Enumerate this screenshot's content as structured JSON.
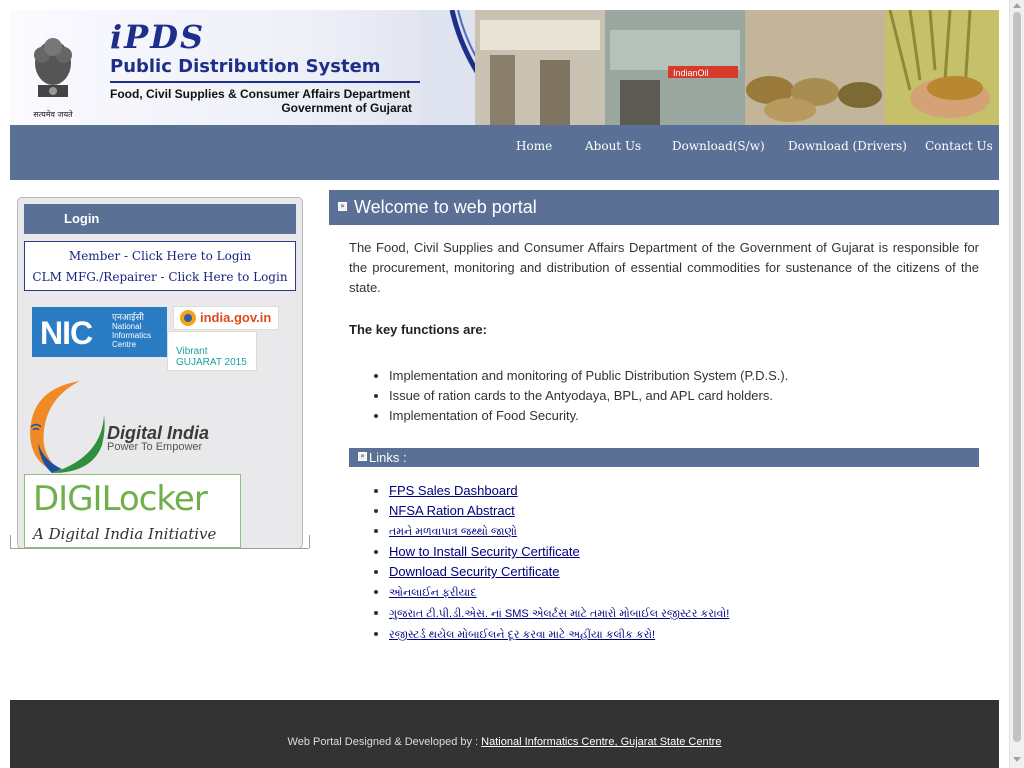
{
  "header": {
    "logo_text": "iPDS",
    "title": "Public Distribution System",
    "department": "Food, Civil Supplies & Consumer Affairs Department",
    "government": "Government of Gujarat",
    "emblem_caption": "सत्यमेव जयते",
    "photo_sign": "IndianOil",
    "brand_color": "#1e2f8a",
    "emblem_icon": "ashoka-emblem-icon"
  },
  "nav": {
    "items": [
      {
        "label": "Home"
      },
      {
        "label": "About Us"
      },
      {
        "label": "Download(S/w)"
      },
      {
        "label": "Download (Drivers)"
      },
      {
        "label": "Contact Us"
      }
    ],
    "bg_color": "#5a7095"
  },
  "sidebar": {
    "login_title": "Login",
    "member_login": "Member - Click Here to Login",
    "clm_login": "CLM MFG./Repairer - Click Here to Login",
    "partners": {
      "nic_big": "NIC",
      "nic_hindi": "एनआईसी",
      "nic_name": "National Informatics Centre",
      "india_gov": "india.gov.in",
      "vibrant": "Vibrant GUJARAT 2015"
    },
    "digital_india": {
      "title": "Digital India",
      "subtitle": "Power To Empower"
    },
    "digilocker": {
      "title": "DIGILocker",
      "subtitle": "A Digital India Initiative"
    }
  },
  "main": {
    "welcome": "Welcome to web portal",
    "intro": "The Food, Civil Supplies and Consumer Affairs Department of the Government of Gujarat is responsible for the procurement, monitoring and distribution of essential commodities for sustenance of the citizens of the state.",
    "key_functions_heading": "The key functions are:",
    "key_functions": [
      "Implementation and monitoring of Public Distribution System (P.D.S.).",
      "Issue of ration cards to the Antyodaya, BPL, and APL card holders.",
      "Implementation of Food Security."
    ],
    "links_heading": "Links :",
    "links": [
      {
        "label": "FPS Sales Dashboard",
        "small": false
      },
      {
        "label": "NFSA Ration Abstract",
        "small": false
      },
      {
        "label": "તમને મળવાપાત્ર જથ્થો જાણો",
        "small": true
      },
      {
        "label": "How to Install Security Certificate",
        "small": false
      },
      {
        "label": "Download Security Certificate",
        "small": false
      },
      {
        "label": "ઓનલાઈન ફરીયાદ",
        "small": true
      },
      {
        "label": "ગુજરાત ટી.પી.ડી.એસ. નાં SMS એલર્ટસ માટે તમારો મોબાઈલ રજીસ્ટર કરાવો!",
        "small": true
      },
      {
        "label": "રજીસ્ટર્ડ થયેલ મોબાઈલને દૂર કરવા માટે અહીંયા કલીક કરો!",
        "small": true
      }
    ],
    "link_color": "#00007f"
  },
  "footer": {
    "prefix": "Web Portal Designed & Developed by :",
    "link": "National Informatics Centre, Gujarat State Centre",
    "bg_color": "#333333"
  }
}
